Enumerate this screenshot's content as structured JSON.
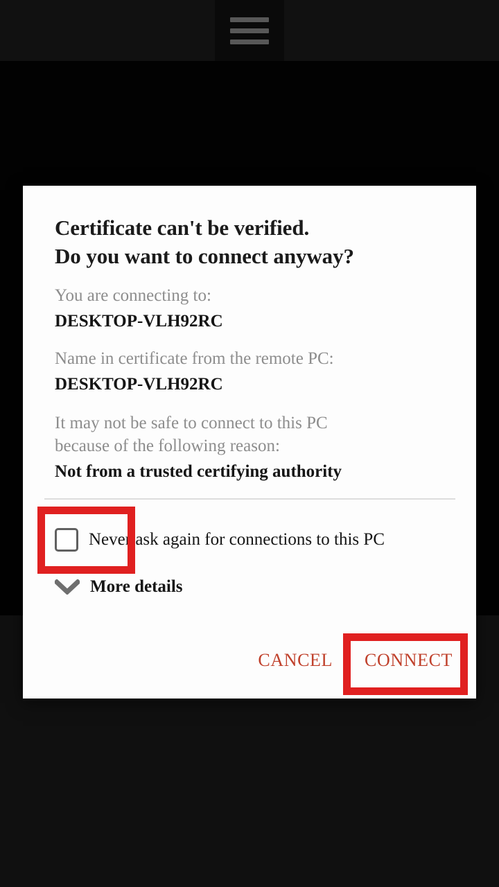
{
  "app": {
    "menu_icon": "hamburger-menu-icon"
  },
  "dialog": {
    "title": "Certificate can't be verified.\nDo you want to connect anyway?",
    "fields": [
      {
        "label": "You are connecting to:",
        "value": "DESKTOP-VLH92RC"
      },
      {
        "label": "Name in certificate from the remote PC:",
        "value": "DESKTOP-VLH92RC"
      },
      {
        "label": "It may not be safe to connect to this PC\nbecause of the following reason:",
        "value": "Not from a trusted certifying authority"
      }
    ],
    "checkbox": {
      "label": "Never ask again for connections to this PC",
      "checked": false
    },
    "more_details": {
      "label": "More details",
      "icon": "chevron-down-icon",
      "expanded": false
    },
    "buttons": {
      "cancel_label": "CANCEL",
      "connect_label": "CONNECT"
    }
  },
  "annotations": [
    {
      "target": "never-ask-again-checkbox",
      "color": "#e02020"
    },
    {
      "target": "connect-button",
      "color": "#e02020"
    }
  ],
  "colors": {
    "accent": "#c0412c",
    "annotation": "#e02020",
    "muted_text": "#8d8d8d",
    "primary_text": "#161616",
    "dialog_background": "#fdfdfd",
    "backdrop": "#080808"
  }
}
